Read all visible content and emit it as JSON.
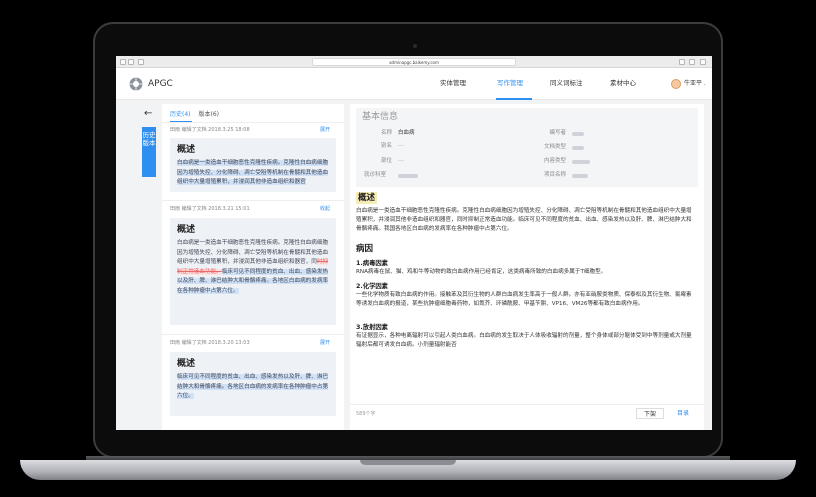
{
  "browser": {
    "url": "adminapgc.baikemy.com"
  },
  "header": {
    "brand": "APGC",
    "nav": [
      "实体管理",
      "写作管理",
      "同义词标注",
      "素材中心"
    ],
    "active_nav": "写作管理",
    "user": "牛亚平 ."
  },
  "sidebar": {
    "back_glyph": "←",
    "history_tab": "历史版本"
  },
  "history": {
    "tab_history": "历史(4)",
    "tab_version": "版本(6)",
    "expand_label": "展开",
    "collapse_label": "收起",
    "entries": [
      {
        "meta": "田雨 编辑了文档 2018.3.25 18:08",
        "toggle": "展开",
        "title": "概述",
        "text": "白血病是一类造血干细胞恶性克隆性疾病。克隆性白血病细胞因为增殖失控、分化障碍、凋亡受阻等机制在骨髓和其他造血组织中大量增殖累积，并浸润其他非造血组织和器官"
      },
      {
        "meta": "田雨 编辑了文档 2018.3.21 15:01",
        "toggle": "收起",
        "title": "概述",
        "text_pre": "白血病是一类造血干细胞恶性克隆性疾病。克隆性白血病细胞因为增殖失控、分化障碍、凋亡受阻等机制在骨髓和其他造血组织中大量增殖累积，并浸润其他非造血组织和器官，同",
        "text_deleted": "时抑制正常造血功能。",
        "text_added": "临床可见不同程度的贫血、出血、感染发热以及肝、脾、淋巴结肿大和骨骼疼痛。各地区白血病的发病率在各种肿瘤中占第六位。"
      },
      {
        "meta": "田雨 编辑了文档 2018.3.20 13:03",
        "toggle": "展开",
        "title": "概述",
        "text": "临床可见不同程度的贫血、出血、感染发热以及肝、脾、淋巴结肿大和骨骼疼痛。各地区白血病的发病率在各种肿瘤中占第六位。"
      }
    ]
  },
  "detail": {
    "section_title": "基本信息",
    "fields_left": [
      {
        "label": "名称",
        "value": "白血病"
      },
      {
        "label": "别名",
        "value": "---"
      },
      {
        "label": "部位",
        "value": "---"
      },
      {
        "label": "就诊科室",
        "value": ""
      }
    ],
    "fields_right": [
      {
        "label": "编写者",
        "value": ""
      },
      {
        "label": "文档类型",
        "value": ""
      },
      {
        "label": "内容类型",
        "value": ""
      },
      {
        "label": "项目名称",
        "value": ""
      }
    ],
    "overview_title": "概述",
    "overview_text": "白血病是一类造血干细胞恶性克隆性疾病。克隆性白血病细胞因为增殖失控、分化障碍、凋亡受阻等机制在骨髓和其他造血组织中大量增殖累积，并浸润其他非造血组织和器官，同时抑制正常造血功能。临床可见不同程度的贫血、出血、感染发热以及肝、脾、淋巴结肿大和骨骼疼痛。我国各地区白血病的发病率在各种肿瘤中占第六位。",
    "cause_title": "病因",
    "causes": [
      {
        "title": "1.病毒因素",
        "text": "RNA病毒在鼠、猫、鸡和牛等动物的致白血病作用已经肯定，这类病毒所致的白血病多属于T细胞型。"
      },
      {
        "title": "2.化学因素",
        "text": "一些化学物质有致白血病的作用。接触苯及其衍生物的人群白血病发生率高于一般人群。亦有亚硝胺类物质、保泰松及其衍生物、氯霉素等诱发白血病的报道，某些抗肿瘤细胞毒药物，如氮芥、环磷酰胺、甲基苄肼、VP16、VM26等都有致白血病作用。"
      },
      {
        "title": "3.放射因素",
        "text": "有证据显示，各种电离辐射可以引起人类白血病。白血病的发生取决于人体吸收辐射的剂量，整个身体或部分躯体受到中等剂量或大剂量辐射后都可诱发白血病。小剂量辐射能否"
      }
    ],
    "word_count": "589个字",
    "btn_download": "下架",
    "btn_catalog": "目录"
  }
}
